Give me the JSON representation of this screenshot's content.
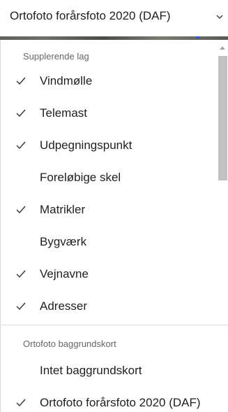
{
  "header": {
    "title": "Ortofoto forårsfoto 2020 (DAF)",
    "chevron_icon": "chevron-down-icon"
  },
  "supplementary": {
    "header": "Supplerende lag",
    "items": [
      {
        "label": "Vindmølle",
        "checked": true
      },
      {
        "label": "Telemast",
        "checked": true
      },
      {
        "label": "Udpegningspunkt",
        "checked": true
      },
      {
        "label": "Foreløbige skel",
        "checked": false
      },
      {
        "label": "Matrikler",
        "checked": true
      },
      {
        "label": "Bygværk",
        "checked": false
      },
      {
        "label": "Vejnavne",
        "checked": true
      },
      {
        "label": "Adresser",
        "checked": true
      }
    ]
  },
  "basemap": {
    "header": "Ortofoto baggrundskort",
    "items": [
      {
        "label": "Intet baggrundskort",
        "checked": false
      },
      {
        "label": "Ortofoto forårsfoto 2020 (DAF)",
        "checked": true
      }
    ]
  },
  "colors": {
    "accent_dot": "#2b56d6",
    "checkmark": "#333333"
  }
}
